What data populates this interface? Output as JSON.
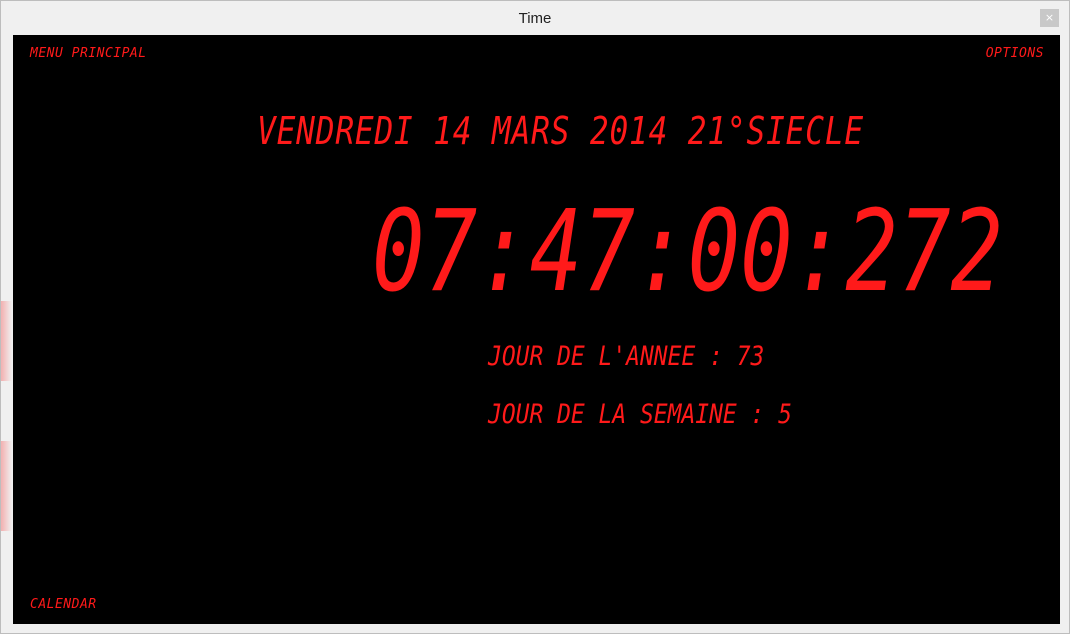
{
  "window": {
    "title": "Time",
    "close_label": "×"
  },
  "menu": {
    "principal": "MENU PRINCIPAL",
    "options": "OPTIONS",
    "calendar": "CALENDAR"
  },
  "display": {
    "date_line": "VENDREDI 14 MARS 2014 21°SIECLE",
    "clock": "07:47:00:272",
    "day_of_year_label": "JOUR DE L'ANNEE : 73",
    "day_of_week_label": "JOUR DE LA SEMAINE : 5"
  },
  "colors": {
    "lcd": "#ff1a1a",
    "background": "#000000"
  }
}
